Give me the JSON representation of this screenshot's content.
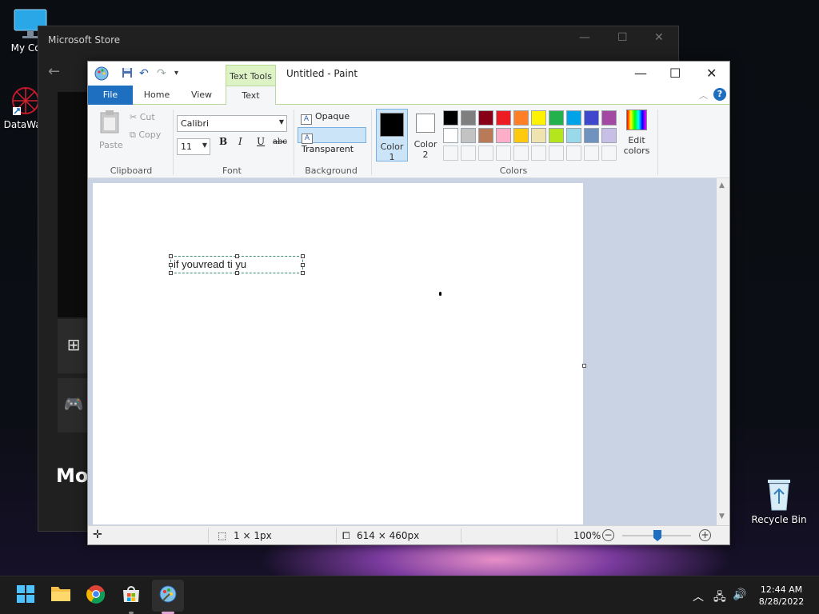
{
  "desktop": {
    "icons": [
      {
        "label": "My Com"
      },
      {
        "label": "DataWag"
      },
      {
        "label": "Recycle Bin"
      }
    ]
  },
  "store": {
    "title": "Microsoft Store",
    "partial_heading": "Mos"
  },
  "paint": {
    "title": "Untitled - Paint",
    "context_tab": "Text Tools",
    "tabs": [
      "File",
      "Home",
      "View",
      "Text"
    ],
    "active_tab": "Text",
    "clipboard": {
      "paste": "Paste",
      "cut": "Cut",
      "copy": "Copy",
      "group": "Clipboard"
    },
    "font": {
      "family": "Calibri",
      "size": "11",
      "bold": "B",
      "italic": "I",
      "underline": "U",
      "strike": "abc",
      "group": "Font"
    },
    "background": {
      "opaque": "Opaque",
      "transparent": "Transparent",
      "selected": "Transparent",
      "group": "Background"
    },
    "colors": {
      "color1_label": "Color 1",
      "color2_label": "Color 2",
      "color1": "#000000",
      "color2": "#ffffff",
      "edit_label": "Edit colors",
      "group": "Colors",
      "palette_row1": [
        "#000000",
        "#7f7f7f",
        "#880015",
        "#ed1c24",
        "#ff7f27",
        "#fff200",
        "#22b14c",
        "#00a2e8",
        "#3f48cc",
        "#a349a4"
      ],
      "palette_row2": [
        "#ffffff",
        "#c3c3c3",
        "#b97a57",
        "#ffaec9",
        "#ffc90e",
        "#efe4b0",
        "#b5e61d",
        "#99d9ea",
        "#7092be",
        "#c8bfe7"
      ]
    },
    "canvas_text": "if youvread ti yu",
    "status": {
      "selection_size": "1 × 1px",
      "image_size": "614 × 460px",
      "zoom": "100%",
      "zoom_level": 0.5
    }
  },
  "taskbar": {
    "time": "12:44 AM",
    "date": "8/28/2022"
  }
}
